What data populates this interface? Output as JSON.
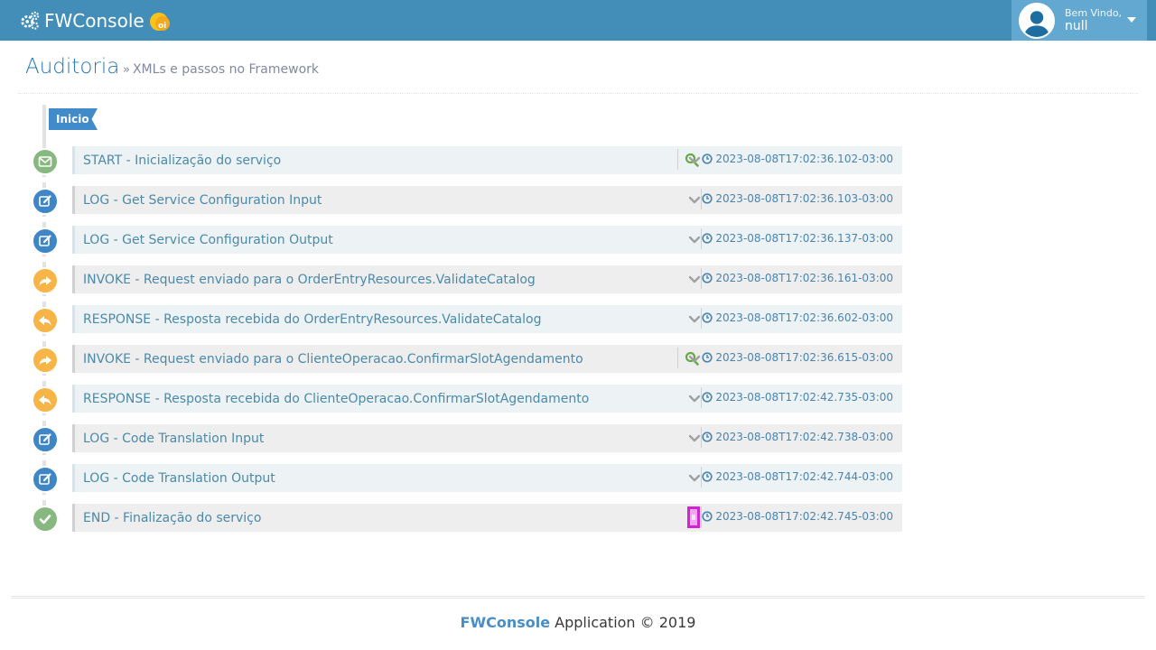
{
  "navbar": {
    "brand": "FWConsole",
    "logo_icon": "oi-logo-icon",
    "gears_icon": "cogs-icon",
    "user": {
      "welcome": "Bem Vindo,",
      "name": "null"
    }
  },
  "page": {
    "title": "Auditoria",
    "subtitle": "XMLs e passos no Framework",
    "subtitle_chevron": "»"
  },
  "timeline": {
    "start_label": "Inicio",
    "items": [
      {
        "title": "START - Inicialização do serviço",
        "time": "2023-08-08T17:02:36.102-03:00",
        "icon": "envelope-icon",
        "color": "#87b87f",
        "search": true
      },
      {
        "title": "LOG - Get Service Configuration Input",
        "time": "2023-08-08T17:02:36.103-03:00",
        "icon": "edit-icon",
        "color": "#3f86c6",
        "search": false
      },
      {
        "title": "LOG - Get Service Configuration Output",
        "time": "2023-08-08T17:02:36.137-03:00",
        "icon": "edit-icon",
        "color": "#3f86c6",
        "search": false
      },
      {
        "title": "INVOKE - Request enviado para o OrderEntryResources.ValidateCatalog",
        "time": "2023-08-08T17:02:36.161-03:00",
        "icon": "share-icon",
        "color": "#f7b548",
        "search": false
      },
      {
        "title": "RESPONSE - Resposta recebida do OrderEntryResources.ValidateCatalog",
        "time": "2023-08-08T17:02:36.602-03:00",
        "icon": "reply-icon",
        "color": "#f7b548",
        "search": false
      },
      {
        "title": "INVOKE - Request enviado para o ClienteOperacao.ConfirmarSlotAgendamento",
        "time": "2023-08-08T17:02:36.615-03:00",
        "icon": "share-icon",
        "color": "#f7b548",
        "search": true
      },
      {
        "title": "RESPONSE - Resposta recebida do ClienteOperacao.ConfirmarSlotAgendamento",
        "time": "2023-08-08T17:02:42.735-03:00",
        "icon": "reply-icon",
        "color": "#f7b548",
        "search": false
      },
      {
        "title": "LOG - Code Translation Input",
        "time": "2023-08-08T17:02:42.738-03:00",
        "icon": "edit-icon",
        "color": "#3f86c6",
        "search": false
      },
      {
        "title": "LOG - Code Translation Output",
        "time": "2023-08-08T17:02:42.744-03:00",
        "icon": "edit-icon",
        "color": "#3f86c6",
        "search": false
      },
      {
        "title": "END - Finalização do serviço",
        "time": "2023-08-08T17:02:42.745-03:00",
        "icon": "check-icon",
        "color": "#87b87f",
        "search": false
      }
    ]
  },
  "footer": {
    "brand": "FWConsole",
    "text": "Application © 2019"
  }
}
